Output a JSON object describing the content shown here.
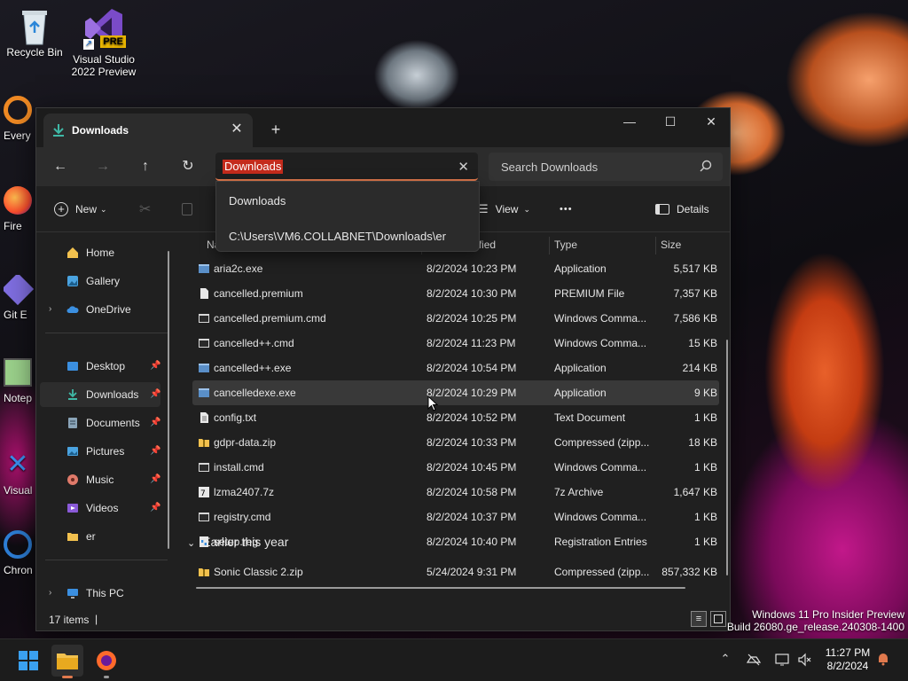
{
  "desktop": {
    "icons": [
      {
        "label": "Recycle Bin"
      },
      {
        "label": "Visual Studio 2022 Preview",
        "badge": "PRE"
      }
    ],
    "partial_labels": [
      "Every",
      "Fire",
      "Git E",
      "Notep",
      "Visual",
      "Chron"
    ]
  },
  "window": {
    "tab_title": "Downloads",
    "tab_close": "✕",
    "new_tab": "+",
    "controls": {
      "minimize": "—",
      "maximize": "☐",
      "close": "✕"
    }
  },
  "navbar": {
    "address_value": "Downloads",
    "address_clear": "✕",
    "search_placeholder": "Search Downloads"
  },
  "autocomplete": {
    "options": [
      "Downloads",
      "C:\\Users\\VM6.COLLABNET\\Downloads\\er"
    ]
  },
  "commandbar": {
    "new_label": "New",
    "view_label": "View",
    "more_label": "•••",
    "details_label": "Details"
  },
  "sidebar": {
    "items": [
      {
        "label": "Home",
        "icon": "home-icon"
      },
      {
        "label": "Gallery",
        "icon": "gallery-icon"
      },
      {
        "label": "OneDrive",
        "icon": "cloud-icon"
      },
      {
        "label": "Desktop",
        "icon": "desktop-folder-icon"
      },
      {
        "label": "Downloads",
        "icon": "downloads-icon"
      },
      {
        "label": "Documents",
        "icon": "documents-icon"
      },
      {
        "label": "Pictures",
        "icon": "pictures-icon"
      },
      {
        "label": "Music",
        "icon": "music-icon"
      },
      {
        "label": "Videos",
        "icon": "videos-icon"
      },
      {
        "label": "er",
        "icon": "folder-icon"
      },
      {
        "label": "This PC",
        "icon": "pc-icon"
      }
    ]
  },
  "filelist": {
    "columns": {
      "name": "Name",
      "date": "Date modified",
      "type": "Type",
      "size": "Size"
    },
    "rows": [
      {
        "name": "aria2c.exe",
        "date": "8/2/2024 10:23 PM",
        "type": "Application",
        "size": "5,517 KB"
      },
      {
        "name": "cancelled.premium",
        "date": "8/2/2024 10:30 PM",
        "type": "PREMIUM File",
        "size": "7,357 KB"
      },
      {
        "name": "cancelled.premium.cmd",
        "date": "8/2/2024 10:25 PM",
        "type": "Windows Comma...",
        "size": "7,586 KB"
      },
      {
        "name": "cancelled++.cmd",
        "date": "8/2/2024 11:23 PM",
        "type": "Windows Comma...",
        "size": "15 KB"
      },
      {
        "name": "cancelled++.exe",
        "date": "8/2/2024 10:54 PM",
        "type": "Application",
        "size": "214 KB"
      },
      {
        "name": "cancelledexe.exe",
        "date": "8/2/2024 10:29 PM",
        "type": "Application",
        "size": "9 KB"
      },
      {
        "name": "config.txt",
        "date": "8/2/2024 10:52 PM",
        "type": "Text Document",
        "size": "1 KB"
      },
      {
        "name": "gdpr-data.zip",
        "date": "8/2/2024 10:33 PM",
        "type": "Compressed (zipp...",
        "size": "18 KB"
      },
      {
        "name": "install.cmd",
        "date": "8/2/2024 10:45 PM",
        "type": "Windows Comma...",
        "size": "1 KB"
      },
      {
        "name": "lzma2407.7z",
        "date": "8/2/2024 10:58 PM",
        "type": "7z Archive",
        "size": "1,647 KB"
      },
      {
        "name": "registry.cmd",
        "date": "8/2/2024 10:37 PM",
        "type": "Windows Comma...",
        "size": "1 KB"
      },
      {
        "name": "setup.reg",
        "date": "8/2/2024 10:40 PM",
        "type": "Registration Entries",
        "size": "1 KB"
      }
    ],
    "group_label": "Earlier this year",
    "group_rows": [
      {
        "name": "Sonic Classic 2.zip",
        "date": "5/24/2024 9:31 PM",
        "type": "Compressed (zipp...",
        "size": "857,332 KB"
      }
    ]
  },
  "statusbar": {
    "count": "17 items",
    "sep": "|"
  },
  "watermark": {
    "line1": "Windows 11 Pro Insider Preview",
    "line2": "Build 26080.ge_release.240308-1400"
  },
  "taskbar": {
    "time": "11:27 PM",
    "date": "8/2/2024"
  },
  "colors": {
    "accent": "#e0794d",
    "selection_highlight": "#c42b1c",
    "taskbar": "#1c1c1c"
  }
}
